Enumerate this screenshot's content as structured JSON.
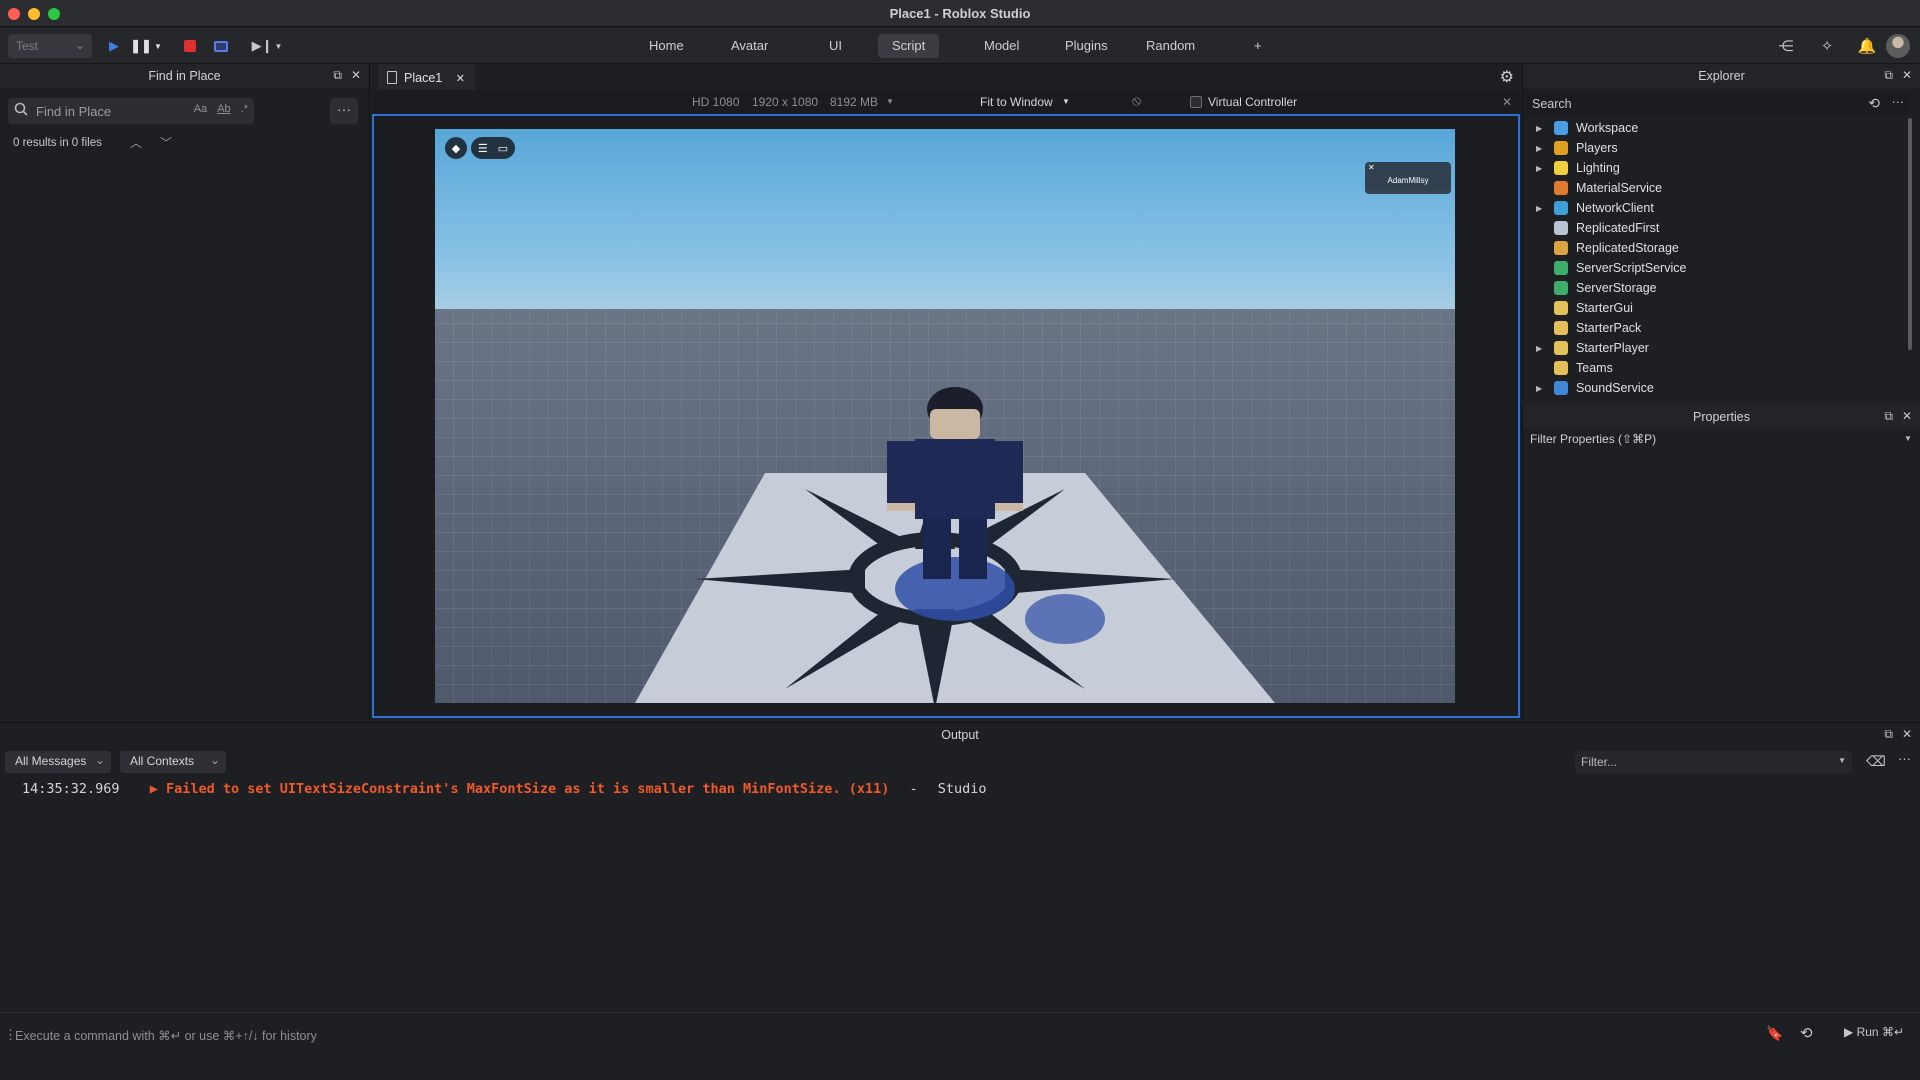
{
  "window": {
    "title": "Place1 - Roblox Studio"
  },
  "toolbar": {
    "test_select": "Test",
    "tabs": [
      "Home",
      "Avatar",
      "UI",
      "Script",
      "Model",
      "Plugins",
      "Random",
      "+"
    ],
    "active_tab": "Script"
  },
  "find_panel": {
    "title": "Find in Place",
    "placeholder": "Find in Place",
    "option_case": "Aa",
    "option_word": "Ab",
    "option_regex": ".*",
    "results": "0 results in 0 files"
  },
  "doc_tab": {
    "label": "Place1"
  },
  "viewport": {
    "resolution": "HD 1080",
    "size": "1920 x 1080",
    "memory": "8192 MB",
    "fit": "Fit to Window",
    "virtual_controller": "Virtual Controller",
    "player_name": "AdamMillsy"
  },
  "explorer": {
    "title": "Explorer",
    "search_placeholder": "Search",
    "items": [
      {
        "label": "Workspace",
        "expandable": true,
        "color": "#4a9de0"
      },
      {
        "label": "Players",
        "expandable": true,
        "color": "#e0a020"
      },
      {
        "label": "Lighting",
        "expandable": true,
        "color": "#f0d040"
      },
      {
        "label": "MaterialService",
        "expandable": false,
        "color": "#e07a30"
      },
      {
        "label": "NetworkClient",
        "expandable": true,
        "color": "#3fa0d8"
      },
      {
        "label": "ReplicatedFirst",
        "expandable": false,
        "color": "#b8c2d0"
      },
      {
        "label": "ReplicatedStorage",
        "expandable": false,
        "color": "#d9a441"
      },
      {
        "label": "ServerScriptService",
        "expandable": false,
        "color": "#3fae6a"
      },
      {
        "label": "ServerStorage",
        "expandable": false,
        "color": "#3fae6a"
      },
      {
        "label": "StarterGui",
        "expandable": false,
        "color": "#e4c05a"
      },
      {
        "label": "StarterPack",
        "expandable": false,
        "color": "#e4c05a"
      },
      {
        "label": "StarterPlayer",
        "expandable": true,
        "color": "#e4c05a"
      },
      {
        "label": "Teams",
        "expandable": false,
        "color": "#e4c05a"
      },
      {
        "label": "SoundService",
        "expandable": true,
        "color": "#3f88d8"
      }
    ]
  },
  "properties": {
    "title": "Properties",
    "filter": "Filter Properties (⇧⌘P)"
  },
  "output": {
    "title": "Output",
    "messages_filter": "All Messages",
    "contexts_filter": "All Contexts",
    "filter_placeholder": "Filter...",
    "log": {
      "time": "14:35:32.969",
      "message": "Failed to set UITextSizeConstraint's MaxFontSize as it is smaller than MinFontSize. (x11)",
      "separator": "-",
      "source": "Studio"
    },
    "command_placeholder": "Execute a command with ⌘↵ or use ⌘+↑/↓ for history",
    "run_label": "Run ⌘↵"
  }
}
